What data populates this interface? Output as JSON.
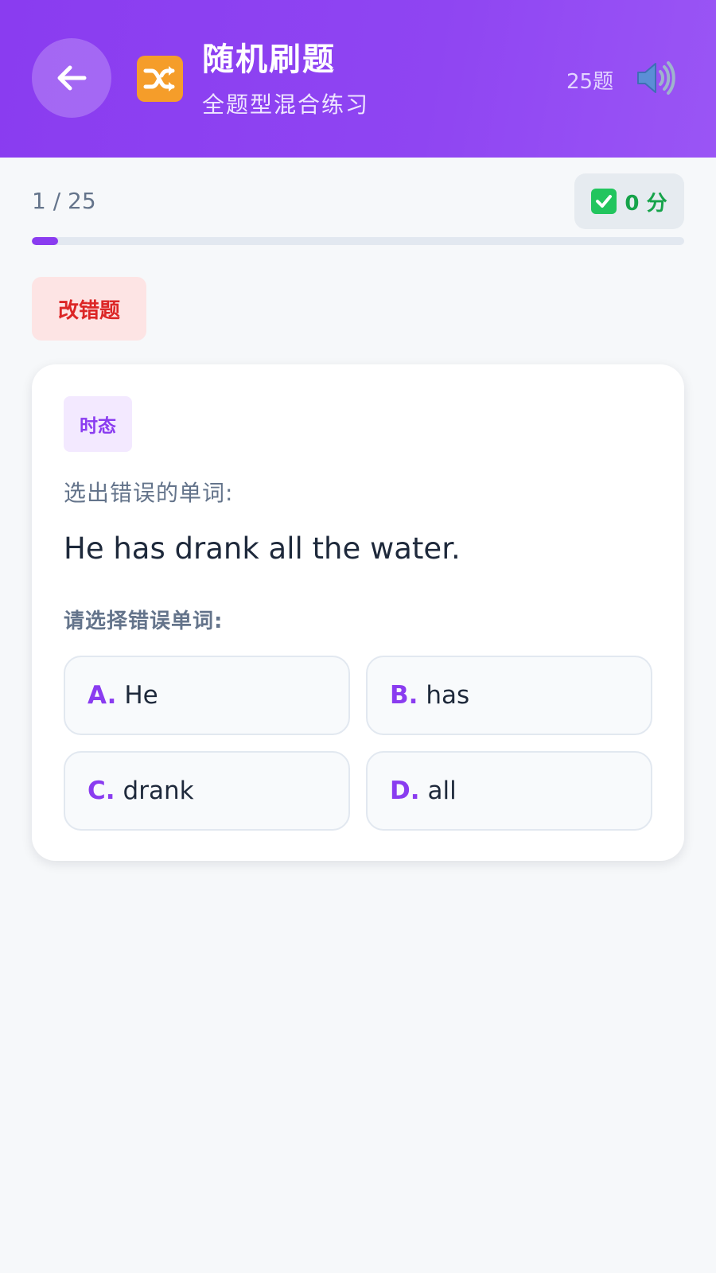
{
  "header": {
    "title": "随机刷题",
    "subtitle": "全题型混合练习",
    "question_count": "25题",
    "back_icon": "arrow-left-icon",
    "mode_icon": "shuffle-icon",
    "sound_icon": "speaker-icon"
  },
  "progress": {
    "text": "1 / 25",
    "current": 1,
    "total": 25,
    "fraction": 0.04
  },
  "score": {
    "icon": "check-icon",
    "text": "0 分"
  },
  "question_type": "改错题",
  "question": {
    "category": "时态",
    "instruction": "选出错误的单词:",
    "sentence": "He has drank all the water.",
    "prompt": "请选择错误单词:",
    "options": [
      {
        "letter": "A.",
        "text": "He"
      },
      {
        "letter": "B.",
        "text": "has"
      },
      {
        "letter": "C.",
        "text": "drank"
      },
      {
        "letter": "D.",
        "text": "all"
      }
    ]
  },
  "colors": {
    "accent": "#8a3cf0",
    "score_green": "#16a34a",
    "tag_red": "#dc2626"
  }
}
